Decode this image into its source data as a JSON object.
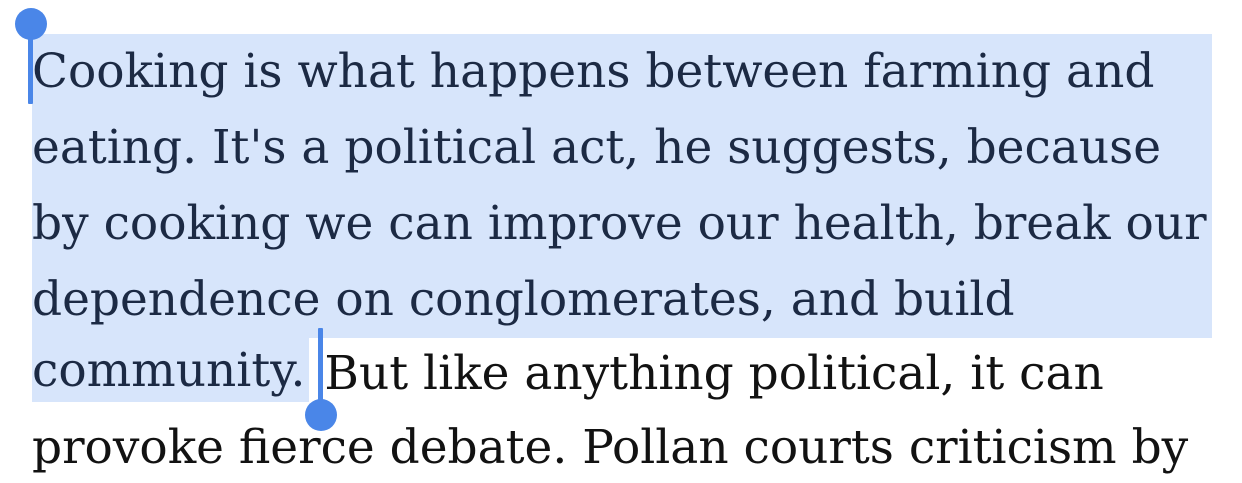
{
  "article": {
    "lines": [
      {
        "selected": "Cooking is what happens between farming and",
        "rest": ""
      },
      {
        "selected": "eating. It's a political act, he suggests, because",
        "rest": ""
      },
      {
        "selected": "by cooking we can improve our health, break our",
        "rest": ""
      },
      {
        "selected": "dependence on conglomerates, and build",
        "rest": ""
      },
      {
        "selected": "community.",
        "rest": " But like anything political, it can"
      },
      {
        "selected": "",
        "rest": "provoke fierce debate. Pollan courts criticism by"
      }
    ]
  },
  "colors": {
    "selection_highlight": "#d7e5fb",
    "selection_handle": "#4a86e8",
    "text": "#121212"
  }
}
